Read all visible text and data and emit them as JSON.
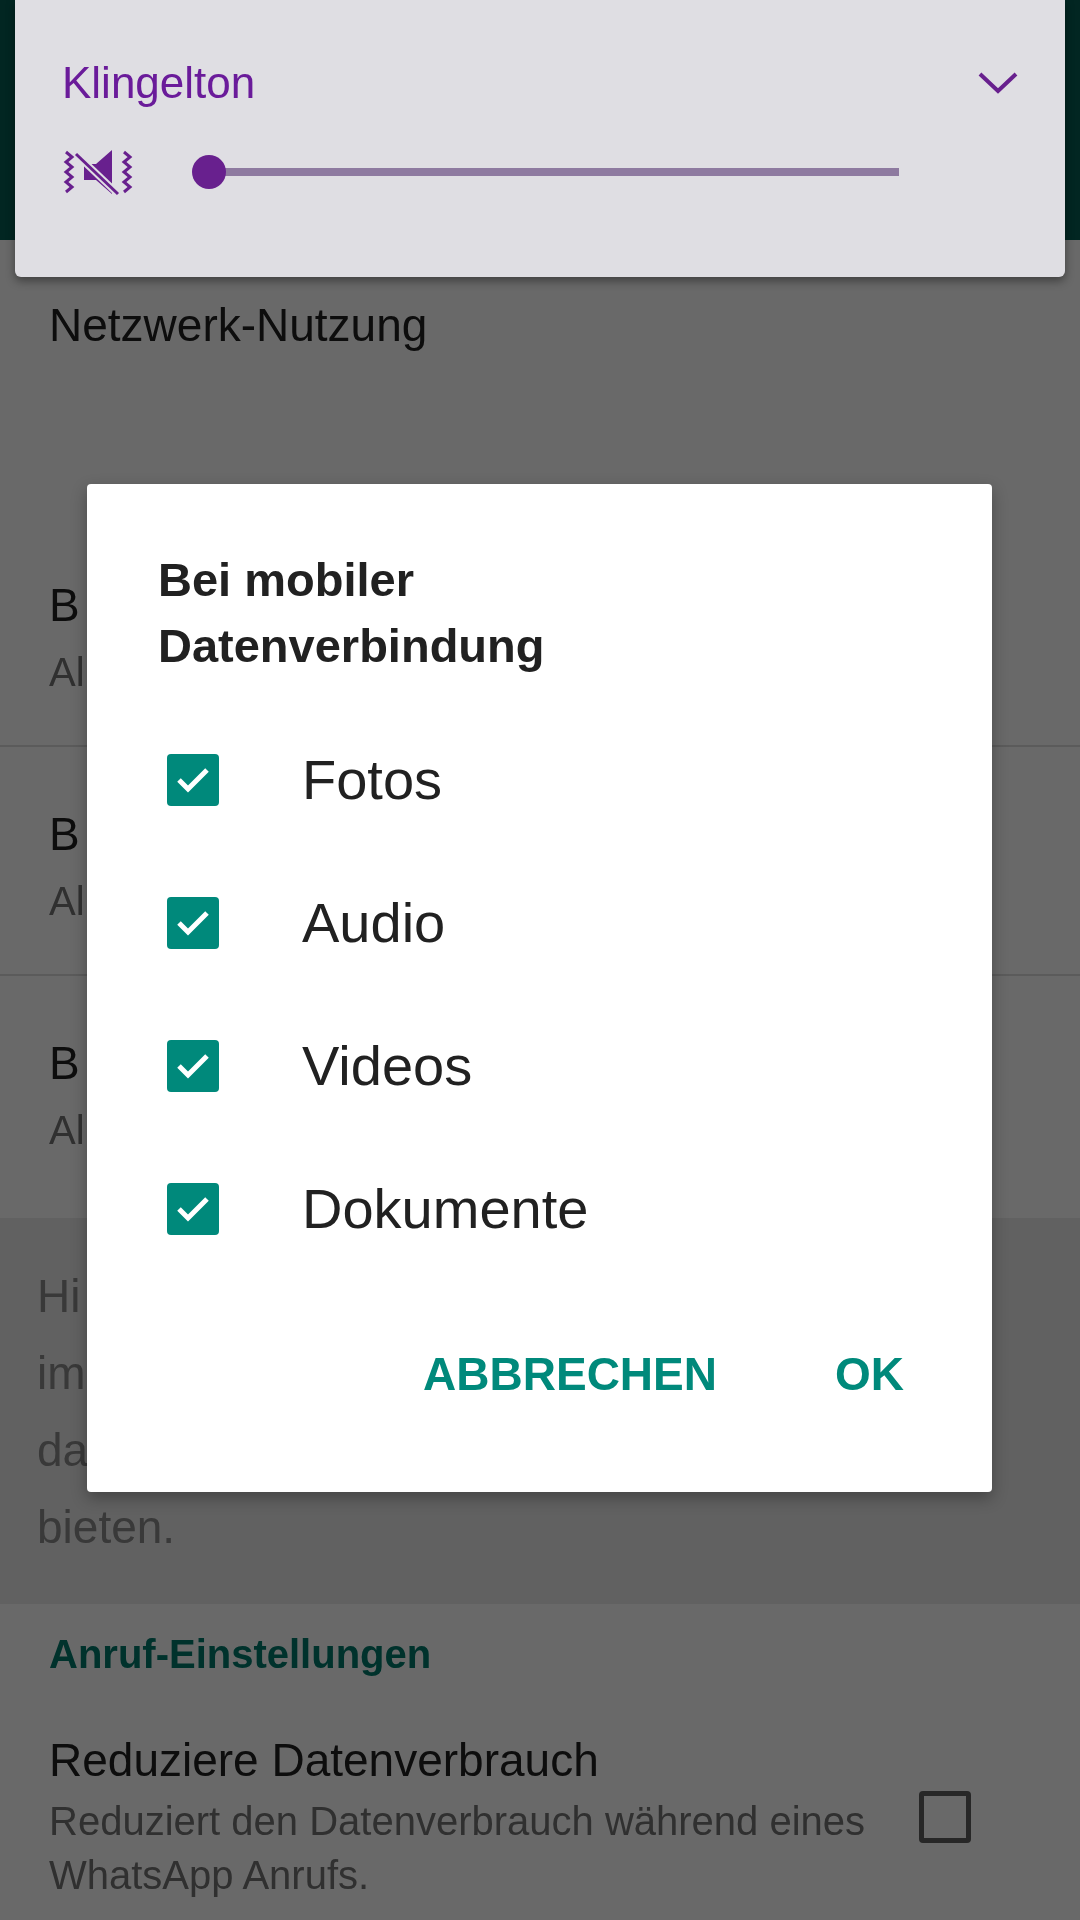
{
  "volume_panel": {
    "title": "Klingelton",
    "muted": true,
    "level": 0
  },
  "settings": [
    {
      "kind": "item",
      "title": "Netzwerk-Nutzung"
    },
    {
      "kind": "item",
      "title": "B",
      "subtitle": "Al"
    },
    {
      "kind": "item",
      "title": "B",
      "subtitle": "Al"
    },
    {
      "kind": "item",
      "title": "B",
      "subtitle": "Al"
    },
    {
      "kind": "info",
      "lines": [
        "Hi",
        "im",
        "da",
        "bieten."
      ]
    },
    {
      "kind": "header",
      "title": "Anruf-Einstellungen"
    },
    {
      "kind": "toggle",
      "title": "Reduziere Datenverbrauch",
      "subtitle": "Reduziert den Datenverbrauch während eines WhatsApp Anrufs.",
      "checked": false
    }
  ],
  "dialog": {
    "title": "Bei mobiler Datenverbindung",
    "options": [
      {
        "label": "Fotos",
        "checked": true
      },
      {
        "label": "Audio",
        "checked": true
      },
      {
        "label": "Videos",
        "checked": true
      },
      {
        "label": "Dokumente",
        "checked": true
      }
    ],
    "buttons": [
      "ABBRECHEN",
      "OK"
    ]
  }
}
